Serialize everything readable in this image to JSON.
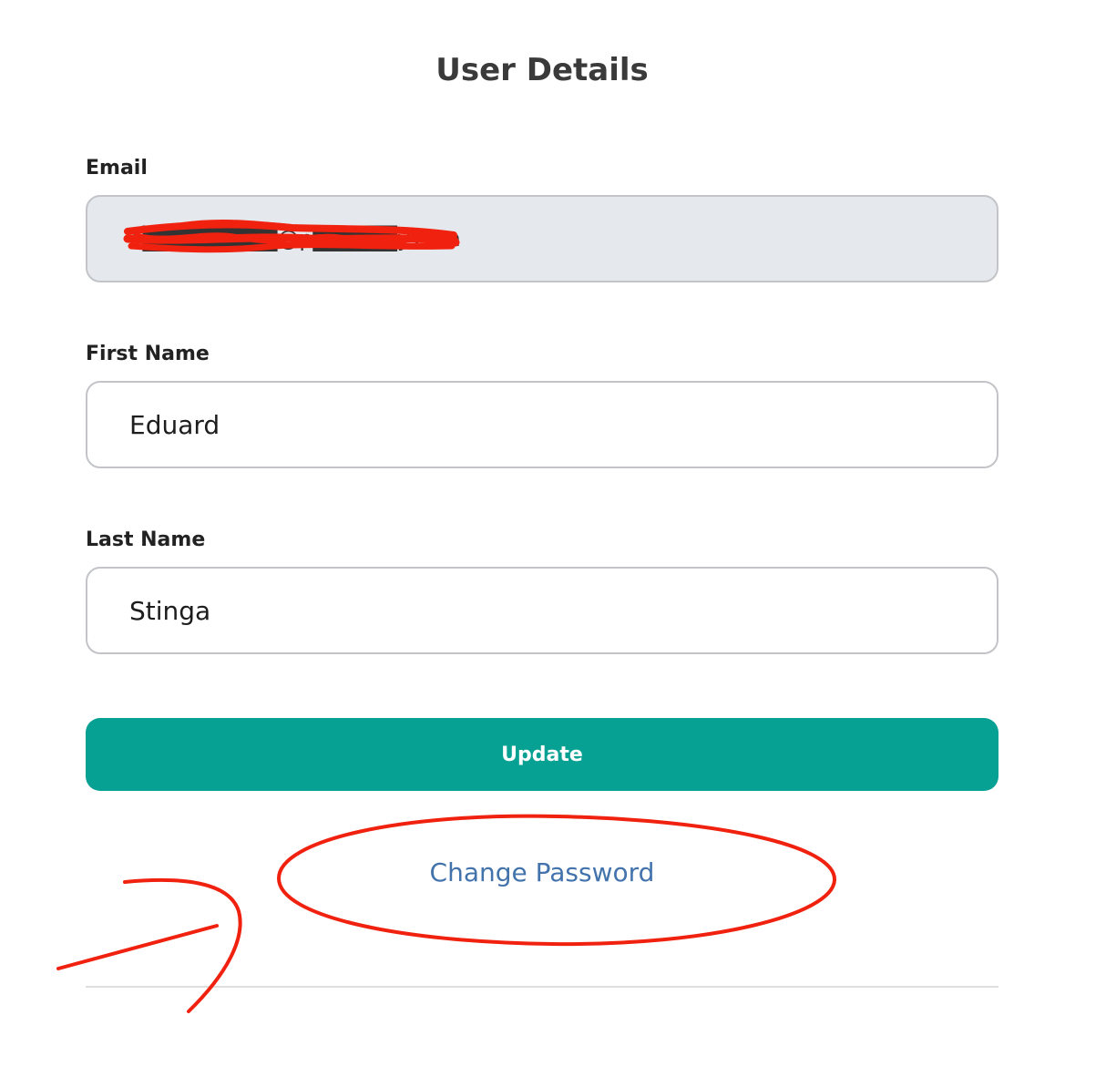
{
  "page": {
    "title": "User Details"
  },
  "form": {
    "email": {
      "label": "Email",
      "value": "e████████@p█████y.com"
    },
    "first_name": {
      "label": "First Name",
      "value": "Eduard"
    },
    "last_name": {
      "label": "Last Name",
      "value": "Stinga"
    },
    "update_label": "Update",
    "change_password_label": "Change Password"
  },
  "colors": {
    "accent": "#07a193",
    "link": "#4273ac",
    "annotation": "#f0220f",
    "disabled_field": "#e5e8ec"
  }
}
